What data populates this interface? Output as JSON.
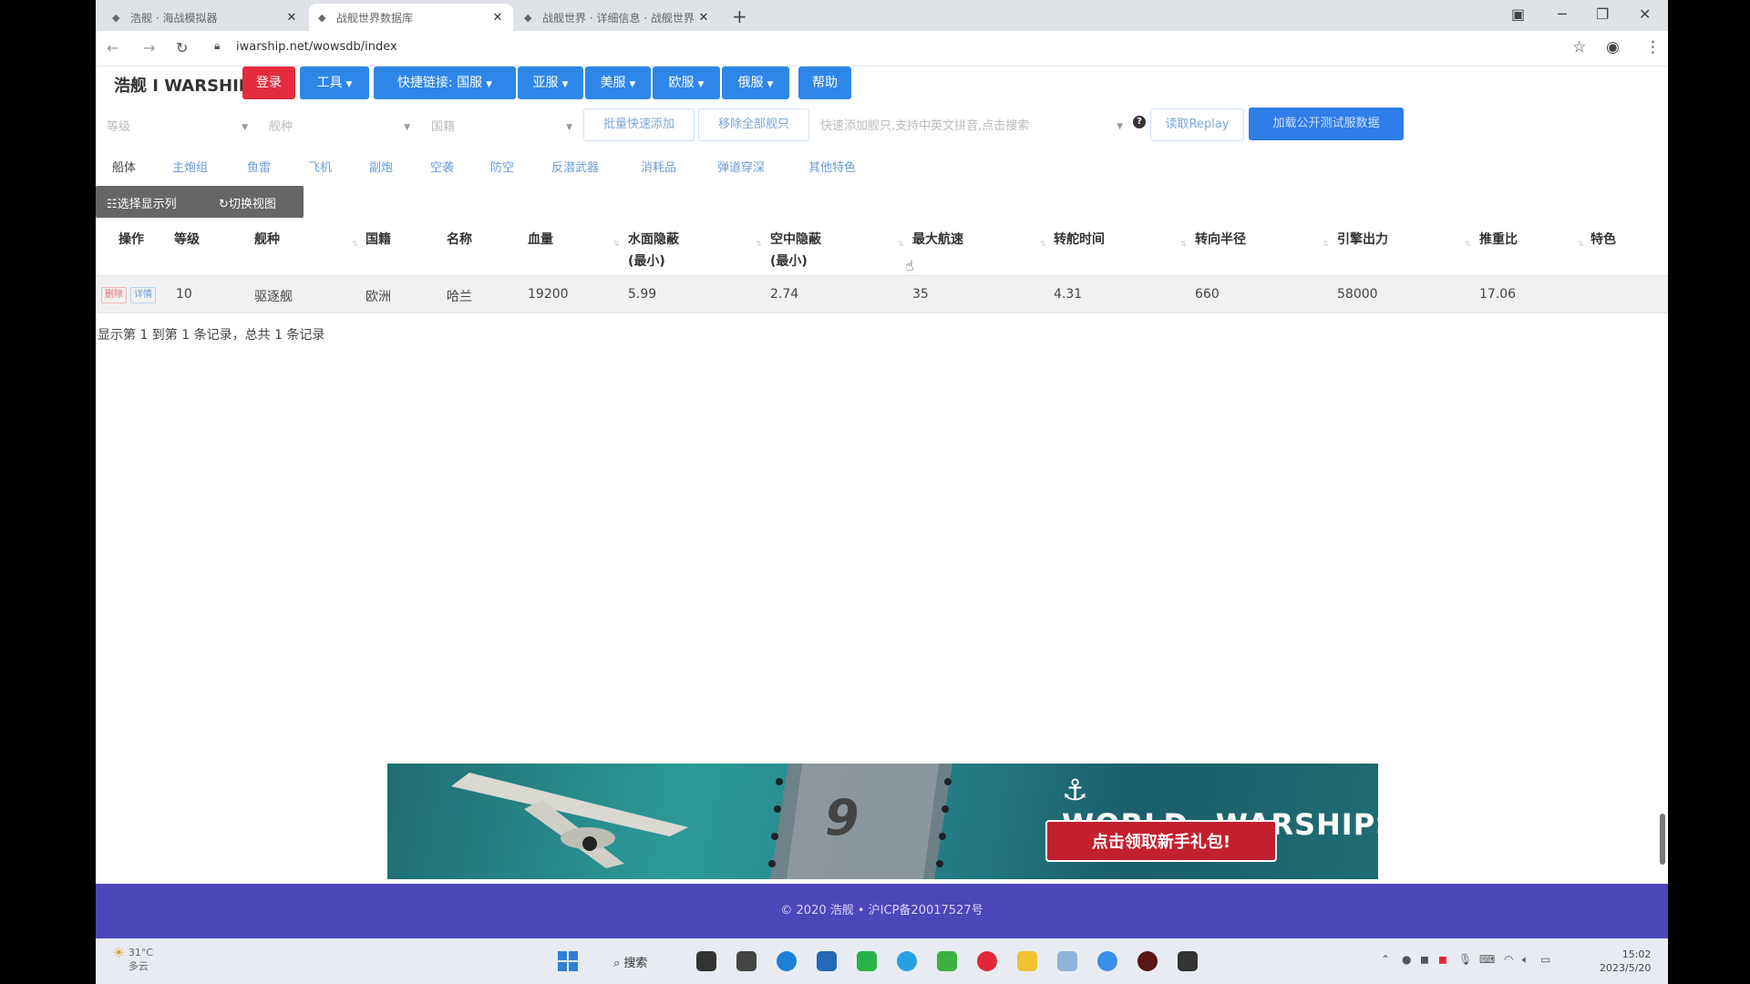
{
  "browser": {
    "tabs": [
      {
        "title": "浩舰 · 海战模拟器",
        "active": false
      },
      {
        "title": "战舰世界数据库",
        "active": true
      },
      {
        "title": "战舰世界 · 详细信息 · 战舰世界",
        "active": false
      }
    ],
    "url": "iwarship.net/wowsdb/index"
  },
  "navbar": {
    "logo": "浩舰 I WARSHIP",
    "login": "登录",
    "tools": "工具",
    "quicklinks": "快捷链接: 国服",
    "asia": "亚服",
    "na": "美服",
    "eu": "欧服",
    "ru": "俄服",
    "help": "帮助"
  },
  "filters": {
    "tier_placeholder": "等级",
    "type_placeholder": "舰种",
    "nation_placeholder": "国籍",
    "batch_add": "批量快速添加",
    "remove_all": "移除全部舰只",
    "quick_add_placeholder": "快速添加舰只,支持中英文拼音,点击搜索",
    "read_replay": "读取Replay",
    "load_test_data": "加载公开测试服数据"
  },
  "category_tabs": [
    "船体",
    "主炮组",
    "鱼雷",
    "飞机",
    "副炮",
    "空袭",
    "防空",
    "反潜武器",
    "消耗品",
    "弹道穿深",
    "其他特色"
  ],
  "toolbar": {
    "select_columns": "选择显示列",
    "switch_view": "切换视图"
  },
  "table": {
    "headers": {
      "action": "操作",
      "tier": "等级",
      "type": "舰种",
      "nation": "国籍",
      "name": "名称",
      "hp": "血量",
      "surface_det_1": "水面隐蔽",
      "surface_det_2": "(最小)",
      "air_det_1": "空中隐蔽",
      "air_det_2": "(最小)",
      "max_speed": "最大航速",
      "rudder": "转舵时间",
      "turn_radius": "转向半径",
      "engine_power": "引擎出力",
      "power_ratio": "推重比",
      "feature": "特色"
    },
    "rows": [
      {
        "delete_label": "删除",
        "detail_label": "详情",
        "tier": "10",
        "type": "驱逐舰",
        "nation": "欧洲",
        "name": "哈兰",
        "hp": "19200",
        "surface_det": "5.99",
        "air_det": "2.74",
        "max_speed": "35",
        "rudder": "4.31",
        "turn_radius": "660",
        "engine_power": "58000",
        "power_ratio": "17.06",
        "feature": ""
      }
    ],
    "page_info": "显示第 1 到第 1 条记录，总共 1 条记录"
  },
  "banner": {
    "tier_digit": "9",
    "brand_world": "WORLD",
    "brand_of": "OF",
    "brand_warships": "WARSHIPS",
    "cta": "点击领取新手礼包!"
  },
  "footer": {
    "text": "© 2020 浩舰 • 沪ICP备20017527号"
  },
  "taskbar": {
    "temp": "31°C",
    "weather": "多云",
    "search": "搜索",
    "time": "15:02",
    "date": "2023/5/20"
  },
  "colors": {
    "primary": "#2e86e8",
    "danger": "#e32c3e",
    "footer": "#4c46b8"
  }
}
